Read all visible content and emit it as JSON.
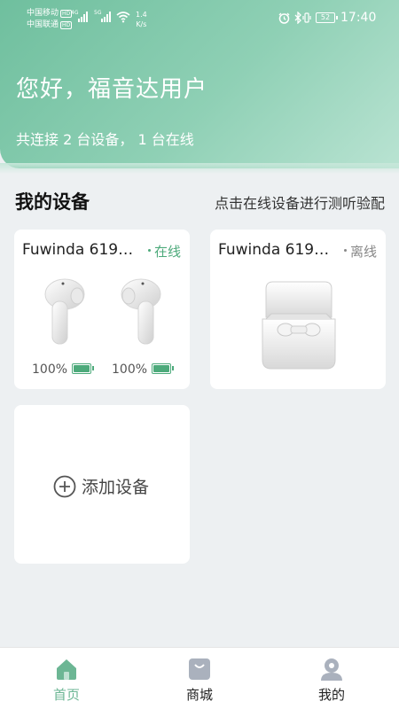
{
  "status_bar": {
    "carrier_1": "中国移动",
    "carrier_2": "中国联通",
    "hd_tag": "HD",
    "net_4g": "4G",
    "net_5g": "5G",
    "speed_value": "1.4",
    "speed_unit": "K/s",
    "battery_level": "52",
    "time": "17:40"
  },
  "header": {
    "greeting": "您好，福音达用户",
    "summary": "共连接 2 台设备， 1 台在线"
  },
  "section": {
    "title": "我的设备",
    "hint": "点击在线设备进行测听验配"
  },
  "devices": [
    {
      "name": "Fuwinda 619…",
      "status": "在线",
      "left_battery": "100%",
      "right_battery": "100%",
      "status_color": "#4daa7b"
    },
    {
      "name": "Fuwinda 619…",
      "status": "离线",
      "status_color": "#888888"
    }
  ],
  "add_device": {
    "label": "添加设备",
    "icon": "plus-circle-icon"
  },
  "tabbar": [
    {
      "label": "首页",
      "icon": "home-icon",
      "active": true
    },
    {
      "label": "商城",
      "icon": "shopping-bag-icon",
      "active": false
    },
    {
      "label": "我的",
      "icon": "person-icon",
      "active": false
    }
  ],
  "colors": {
    "accent": "#6cb694",
    "header_gradient_start": "#6fbf9e",
    "background": "#edf0f2"
  }
}
